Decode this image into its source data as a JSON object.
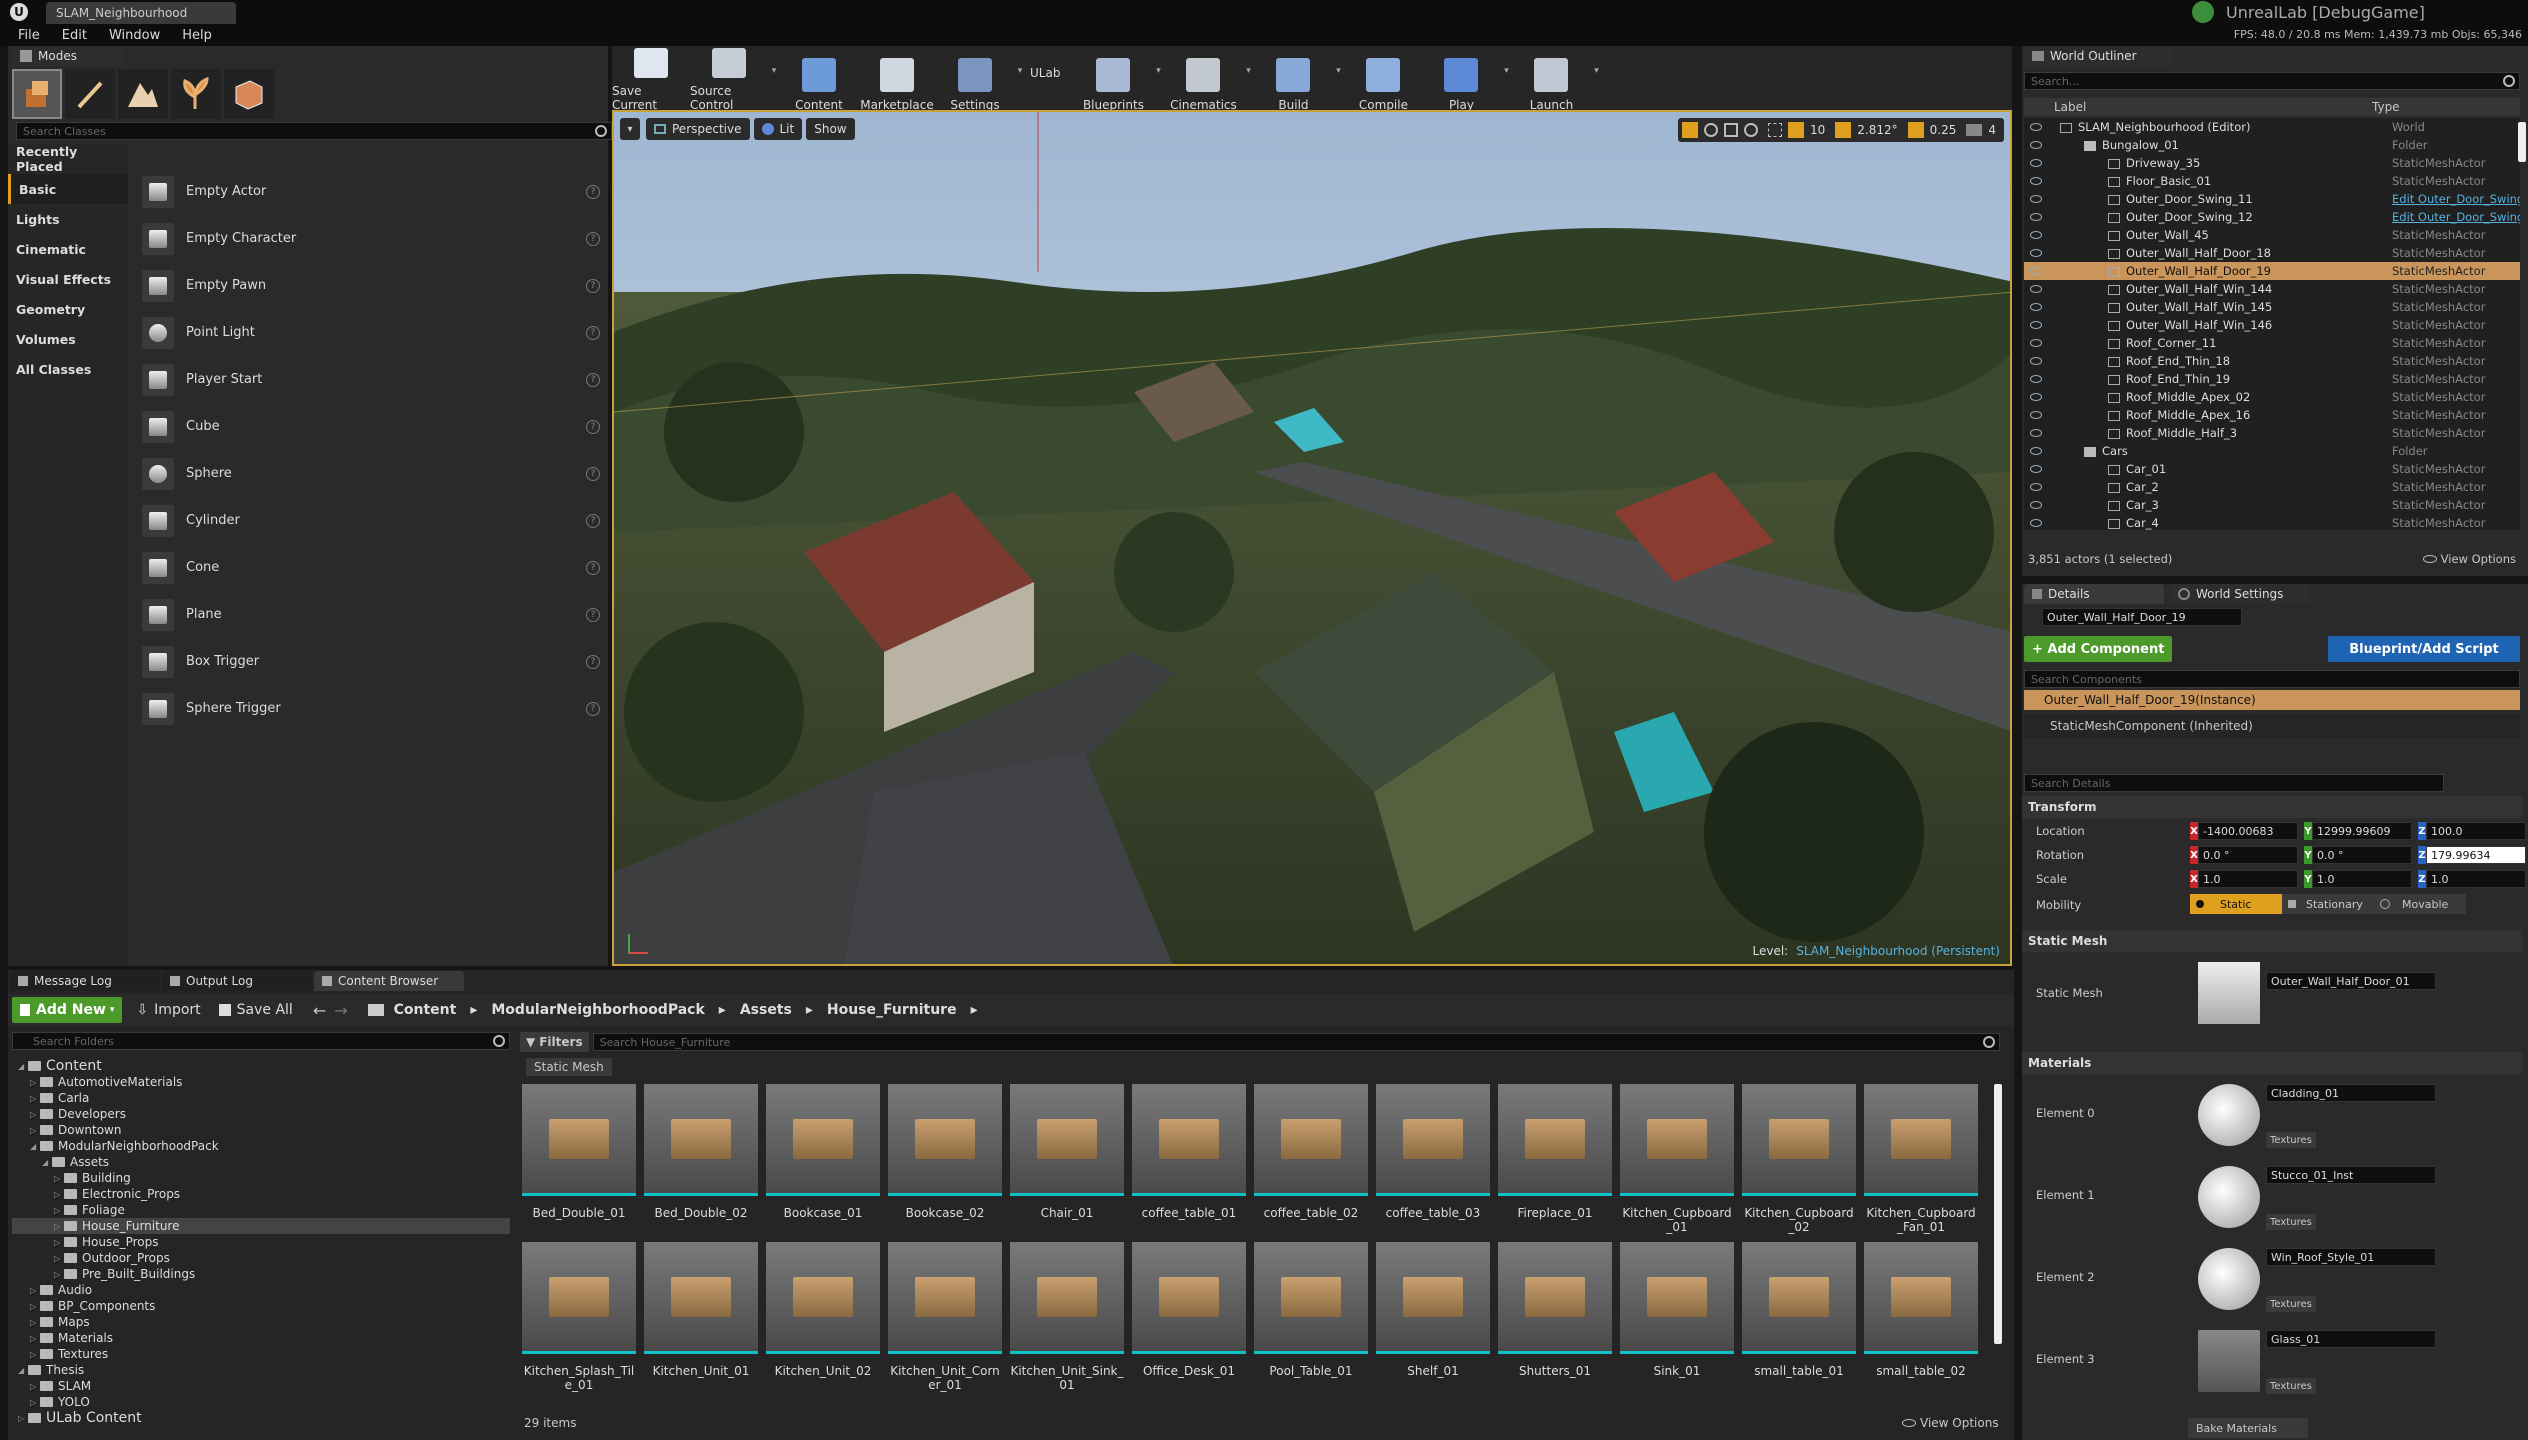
{
  "window": {
    "tab": "SLAM_Neighbourhood",
    "app_title": "UnrealLab [DebugGame]",
    "stats": "FPS: 48.0 / 20.8 ms  Mem: 1,439.73 mb  Objs: 65,346"
  },
  "menu": [
    "File",
    "Edit",
    "Window",
    "Help"
  ],
  "modes": {
    "tab": "Modes",
    "search_placeholder": "Search Classes",
    "categories": [
      "Recently Placed",
      "Basic",
      "Lights",
      "Cinematic",
      "Visual Effects",
      "Geometry",
      "Volumes",
      "All Classes"
    ],
    "actors": [
      "Empty Actor",
      "Empty Character",
      "Empty Pawn",
      "Point Light",
      "Player Start",
      "Cube",
      "Sphere",
      "Cylinder",
      "Cone",
      "Plane",
      "Box Trigger",
      "Sphere Trigger"
    ]
  },
  "toolbar": {
    "buttons": [
      "Save Current",
      "Source Control",
      "Content",
      "Marketplace",
      "Settings",
      "Blueprints",
      "Cinematics",
      "Build",
      "Compile",
      "Play",
      "Launch"
    ],
    "ulab": "ULab"
  },
  "viewport": {
    "perspective": "Perspective",
    "lit": "Lit",
    "show": "Show",
    "grid": "10",
    "angle": "2.812°",
    "scale": "0.25",
    "speed": "4",
    "level_label": "Level:",
    "level_name": "SLAM_Neighbourhood (Persistent)"
  },
  "outliner": {
    "tab": "World Outliner",
    "search_placeholder": "Search...",
    "col_label": "Label",
    "col_type": "Type",
    "rows": [
      {
        "label": "SLAM_Neighbourhood (Editor)",
        "type": "World",
        "indent": 0
      },
      {
        "label": "Bungalow_01",
        "type": "Folder",
        "indent": 1
      },
      {
        "label": "Driveway_35",
        "type": "StaticMeshActor",
        "indent": 2
      },
      {
        "label": "Floor_Basic_01",
        "type": "StaticMeshActor",
        "indent": 2
      },
      {
        "label": "Outer_Door_Swing_11",
        "type": "Edit Outer_Door_Swing",
        "indent": 2
      },
      {
        "label": "Outer_Door_Swing_12",
        "type": "Edit Outer_Door_Swing",
        "indent": 2
      },
      {
        "label": "Outer_Wall_45",
        "type": "StaticMeshActor",
        "indent": 2
      },
      {
        "label": "Outer_Wall_Half_Door_18",
        "type": "StaticMeshActor",
        "indent": 2
      },
      {
        "label": "Outer_Wall_Half_Door_19",
        "type": "StaticMeshActor",
        "indent": 2
      },
      {
        "label": "Outer_Wall_Half_Win_144",
        "type": "StaticMeshActor",
        "indent": 2
      },
      {
        "label": "Outer_Wall_Half_Win_145",
        "type": "StaticMeshActor",
        "indent": 2
      },
      {
        "label": "Outer_Wall_Half_Win_146",
        "type": "StaticMeshActor",
        "indent": 2
      },
      {
        "label": "Roof_Corner_11",
        "type": "StaticMeshActor",
        "indent": 2
      },
      {
        "label": "Roof_End_Thin_18",
        "type": "StaticMeshActor",
        "indent": 2
      },
      {
        "label": "Roof_End_Thin_19",
        "type": "StaticMeshActor",
        "indent": 2
      },
      {
        "label": "Roof_Middle_Apex_02",
        "type": "StaticMeshActor",
        "indent": 2
      },
      {
        "label": "Roof_Middle_Apex_16",
        "type": "StaticMeshActor",
        "indent": 2
      },
      {
        "label": "Roof_Middle_Half_3",
        "type": "StaticMeshActor",
        "indent": 2
      },
      {
        "label": "Cars",
        "type": "Folder",
        "indent": 1
      },
      {
        "label": "Car_01",
        "type": "StaticMeshActor",
        "indent": 2
      },
      {
        "label": "Car_2",
        "type": "StaticMeshActor",
        "indent": 2
      },
      {
        "label": "Car_3",
        "type": "StaticMeshActor",
        "indent": 2
      },
      {
        "label": "Car_4",
        "type": "StaticMeshActor",
        "indent": 2
      }
    ],
    "selected_index": 8,
    "status": "3,851 actors (1 selected)",
    "view_options": "View Options"
  },
  "details": {
    "tab": "Details",
    "tab2": "World Settings",
    "name": "Outer_Wall_Half_Door_19",
    "add_component": "+ Add Component",
    "blueprint": "Blueprint/Add Script",
    "search_components": "Search Components",
    "instance": "Outer_Wall_Half_Door_19(Instance)",
    "component": "StaticMeshComponent (Inherited)",
    "search_details": "Search Details",
    "transform": "Transform",
    "location_label": "Location",
    "rotation_label": "Rotation",
    "scale_label": "Scale",
    "mobility_label": "Mobility",
    "location": [
      "-1400.00683",
      "12999.99609",
      "100.0"
    ],
    "rotation": [
      "0.0 °",
      "0.0 °",
      "179.99634"
    ],
    "scale": [
      "1.0",
      "1.0",
      "1.0"
    ],
    "mobility": [
      "Static",
      "Stationary",
      "Movable"
    ],
    "static_mesh_section": "Static Mesh",
    "static_mesh_label": "Static Mesh",
    "static_mesh_value": "Outer_Wall_Half_Door_01",
    "materials_section": "Materials",
    "materials": [
      {
        "element": "Element 0",
        "name": "Cladding_01"
      },
      {
        "element": "Element 1",
        "name": "Stucco_01_Inst"
      },
      {
        "element": "Element 2",
        "name": "Win_Roof_Style_01"
      },
      {
        "element": "Element 3",
        "name": "Glass_01"
      }
    ],
    "textures": "Textures",
    "bake": "Bake Materials"
  },
  "bottom_tabs": [
    "Message Log",
    "Output Log",
    "Content Browser"
  ],
  "content": {
    "add_new": "Add New",
    "import": "Import",
    "save_all": "Save All",
    "path": [
      "Content",
      "ModularNeighborhoodPack",
      "Assets",
      "House_Furniture"
    ],
    "search_folders": "Search Folders",
    "filters": "Filters",
    "search_assets": "Search House_Furniture",
    "filter_chip": "Static Mesh",
    "tree": [
      {
        "label": "Content",
        "indent": 0
      },
      {
        "label": "AutomotiveMaterials",
        "indent": 1
      },
      {
        "label": "Carla",
        "indent": 1
      },
      {
        "label": "Developers",
        "indent": 1
      },
      {
        "label": "Downtown",
        "indent": 1
      },
      {
        "label": "ModularNeighborhoodPack",
        "indent": 1
      },
      {
        "label": "Assets",
        "indent": 2
      },
      {
        "label": "Building",
        "indent": 3
      },
      {
        "label": "Electronic_Props",
        "indent": 3
      },
      {
        "label": "Foliage",
        "indent": 3
      },
      {
        "label": "House_Furniture",
        "indent": 3
      },
      {
        "label": "House_Props",
        "indent": 3
      },
      {
        "label": "Outdoor_Props",
        "indent": 3
      },
      {
        "label": "Pre_Built_Buildings",
        "indent": 3
      },
      {
        "label": "Audio",
        "indent": 1
      },
      {
        "label": "BP_Components",
        "indent": 1
      },
      {
        "label": "Maps",
        "indent": 1
      },
      {
        "label": "Materials",
        "indent": 1
      },
      {
        "label": "Textures",
        "indent": 1
      },
      {
        "label": "Thesis",
        "indent": 0
      },
      {
        "label": "SLAM",
        "indent": 1
      },
      {
        "label": "YOLO",
        "indent": 1
      },
      {
        "label": "ULab Content",
        "indent": 0
      }
    ],
    "tree_selected": 10,
    "assets": [
      "Bed_Double_01",
      "Bed_Double_02",
      "Bookcase_01",
      "Bookcase_02",
      "Chair_01",
      "coffee_table_01",
      "coffee_table_02",
      "coffee_table_03",
      "Fireplace_01",
      "Kitchen_Cupboard_01",
      "Kitchen_Cupboard_02",
      "Kitchen_Cupboard_Fan_01",
      "Kitchen_Splash_Tile_01",
      "Kitchen_Unit_01",
      "Kitchen_Unit_02",
      "Kitchen_Unit_Corner_01",
      "Kitchen_Unit_Sink_01",
      "Office_Desk_01",
      "Pool_Table_01",
      "Shelf_01",
      "Shutters_01",
      "Sink_01",
      "small_table_01",
      "small_table_02"
    ],
    "count": "29 items",
    "view_options": "View Options"
  },
  "colors": {
    "accent": "#e0a01f",
    "selection": "#c9955a",
    "cyan": "#0fc2c8",
    "green": "#4c9a2a",
    "blue": "#1f63b3"
  }
}
